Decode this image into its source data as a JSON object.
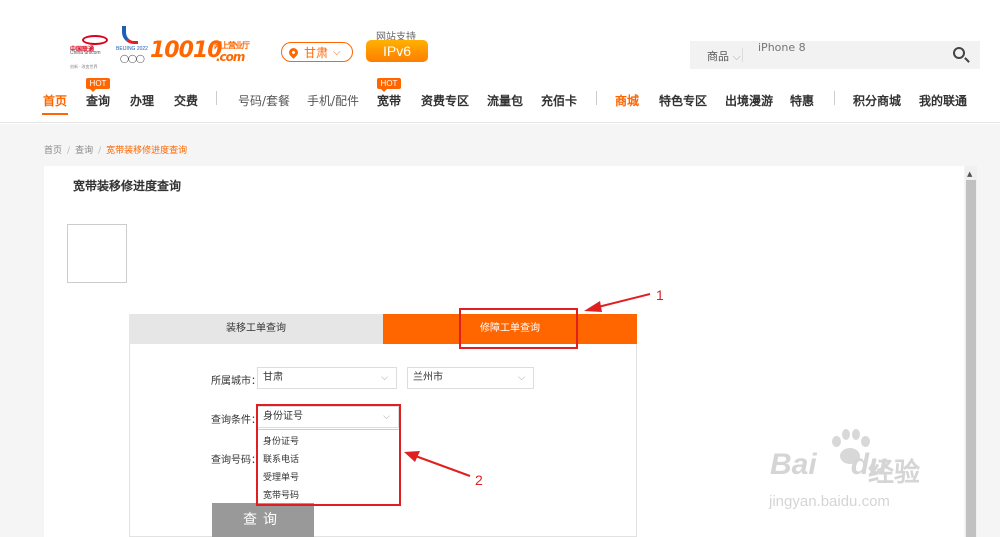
{
  "header": {
    "logo_unicom": {
      "cn": "中国联通",
      "en": "China unicom",
      "sub": "创新 · 改变世界"
    },
    "logo_beijing": {
      "cn": "北京2022",
      "en": "BEIJING 2022"
    },
    "logo_10010": {
      "num": "10010",
      "cn": "网上营业厅",
      "com": ".com"
    },
    "region": "甘肃",
    "ipv6_label": "网站支持",
    "ipv6": "IPv6",
    "search": {
      "category": "商品",
      "placeholder": "iPhone 8"
    }
  },
  "nav": {
    "items": [
      "首页",
      "查询",
      "办理",
      "交费",
      "号码/套餐",
      "手机/配件",
      "宽带",
      "资费专区",
      "流量包",
      "充佰卡",
      "商城",
      "特色专区",
      "出境漫游",
      "特惠",
      "积分商城",
      "我的联通"
    ],
    "hot_badge": "HOT"
  },
  "breadcrumb": {
    "home": "首页",
    "query": "查询",
    "current": "宽带装移修进度查询"
  },
  "panel": {
    "title": "宽带装移修进度查询",
    "tabs": [
      "装移工单查询",
      "修障工单查询"
    ],
    "city_label": "所属城市：",
    "province": "甘肃",
    "city": "兰州市",
    "cond_label": "查询条件：",
    "cond_value": "身份证号",
    "number_label": "查询号码：",
    "options": [
      "身份证号",
      "联系电话",
      "受理单号",
      "宽带号码"
    ],
    "query_button": "查询"
  },
  "annotations": {
    "n1": "1",
    "n2": "2"
  },
  "watermark": {
    "brand": "Bai",
    "brand2": "du",
    "cn": "经验",
    "url": "jingyan.baidu.com"
  },
  "colors": {
    "accent": "#ff6600",
    "annotation": "#e02020"
  }
}
